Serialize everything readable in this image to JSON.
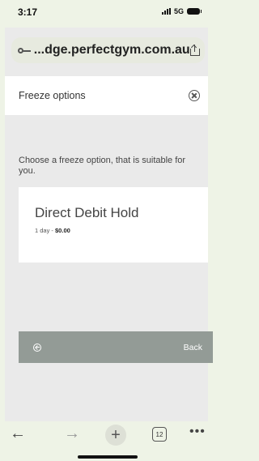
{
  "status_bar": {
    "time": "3:17",
    "network": "5G"
  },
  "url_bar": {
    "url": "...dge.perfectgym.com.au"
  },
  "modal": {
    "title": "Freeze options",
    "intro": "Choose a freeze option, that is suitable for you."
  },
  "option": {
    "name": "Direct Debit Hold",
    "duration": "1 day - ",
    "price": "$0.00"
  },
  "back_bar": {
    "label": "Back"
  },
  "toolbar": {
    "tab_count": "12"
  }
}
